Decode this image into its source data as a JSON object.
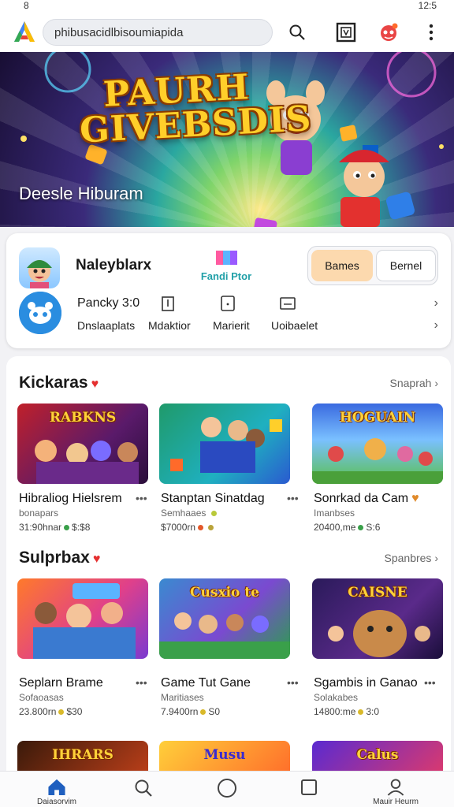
{
  "status_bar": {
    "left": "8",
    "right": "12:5"
  },
  "search": {
    "value": "phibusacidlbisoumiapida"
  },
  "hero": {
    "title_line1": "PAURH",
    "title_line2": "GIVEBSDIS",
    "subtitle": "Deesle Hiburam"
  },
  "promo": {
    "app_name": "Naleyblarx",
    "brand_text": "Fandi Ptor",
    "seg_a": "Bames",
    "seg_b": "Bernel",
    "row_top": "Pancky 3:0",
    "items": [
      "Dnslaaplats",
      "Mdaktior",
      "Marierit",
      "Uoibaelet"
    ]
  },
  "section1": {
    "title": "Kickaras",
    "more": "Snaprah",
    "games": [
      {
        "tile_title": "RABKNS",
        "name": "Hibraliog Hielsrem",
        "dev": "bonapars",
        "meta": "31:90hnar",
        "meta2": "$:$8",
        "tag": ""
      },
      {
        "tile_title": "",
        "name": "Stanptan Sinatdag",
        "dev": "Semhaaes",
        "meta": "$7000rn",
        "meta2": "",
        "tag": ""
      },
      {
        "tile_title": "HOGUAIN",
        "name": "Sonrkad da Cam",
        "dev": "Imanbses",
        "meta": "20400,me",
        "meta2": "S:6",
        "tag": ""
      }
    ]
  },
  "section2": {
    "title": "Sulprbax",
    "more": "Spanbres",
    "games": [
      {
        "tile_title": "",
        "name": "Seplarn Brame",
        "dev": "Sofaoasas",
        "meta": "23.800rn",
        "meta2": "$30",
        "tag": ""
      },
      {
        "tile_title": "Cusxio te",
        "name": "Game Tut Gane",
        "dev": "Maritiases",
        "meta": "7.9400rn",
        "meta2": "S0",
        "tag": ""
      },
      {
        "tile_title": "CAISNE",
        "name": "Sgambis in Ganao",
        "dev": "Solakabes",
        "meta": "14800:me",
        "meta2": "3:0",
        "tag": ""
      }
    ]
  },
  "section3": {
    "tiles": [
      "IHRARS",
      "Musu",
      "Calus"
    ]
  },
  "nav": {
    "home": "Daiasorvim",
    "profile": "Mauir Heurm"
  },
  "colors": {
    "accent": "#3a7bd5",
    "seg_active": "#fcd9ae",
    "heart": "#e53030"
  }
}
